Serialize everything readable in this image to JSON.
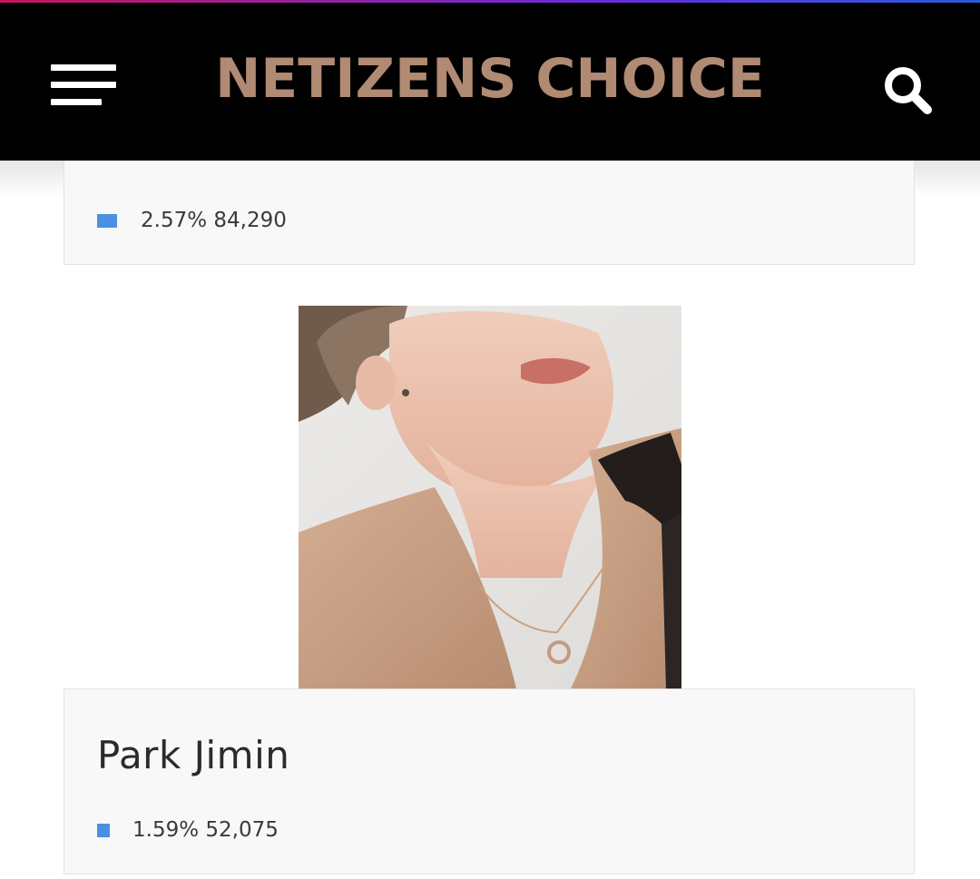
{
  "header": {
    "brand": "NETIZENS CHOICE",
    "menu_icon": "hamburger-menu-icon",
    "search_icon": "search-icon",
    "background": "#000000",
    "brand_color": "#b08a73"
  },
  "entries": [
    {
      "name": "",
      "percent": "2.57%",
      "votes": "84,290",
      "stat_text": "2.57% 84,290",
      "bar_color": "#4a90e2"
    },
    {
      "name": "Park Jimin",
      "percent": "1.59%",
      "votes": "52,075",
      "stat_text": "1.59% 52,075",
      "bar_color": "#4a90e2",
      "photo": "portrait-photo"
    }
  ]
}
